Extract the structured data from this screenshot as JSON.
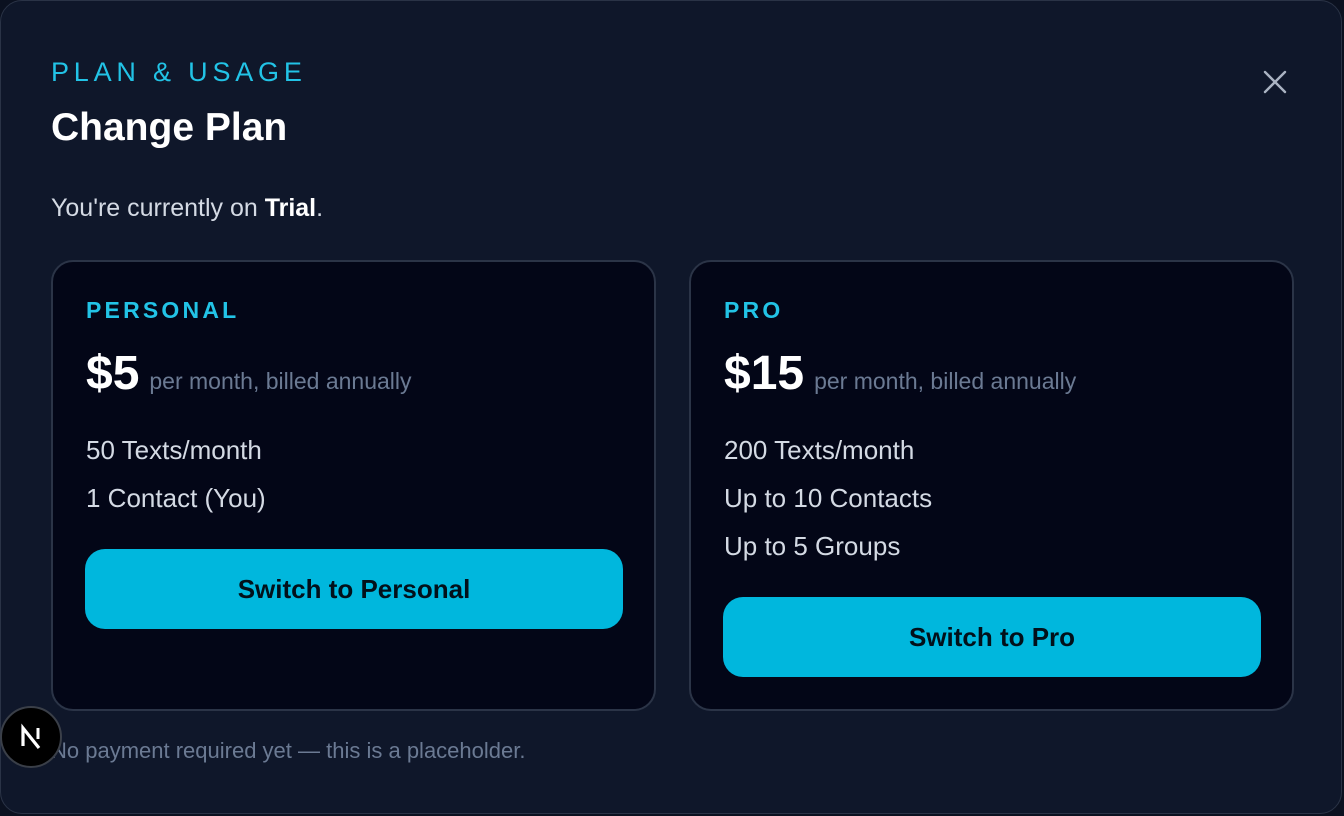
{
  "header": {
    "eyebrow": "PLAN & USAGE",
    "title": "Change Plan"
  },
  "current_plan": {
    "prefix": "You're currently on ",
    "plan": "Trial",
    "suffix": "."
  },
  "plans": [
    {
      "name": "PERSONAL",
      "price": "$5",
      "billing": "per month, billed annually",
      "features": [
        "50 Texts/month",
        "1 Contact (You)"
      ],
      "button_label": "Switch to Personal"
    },
    {
      "name": "PRO",
      "price": "$15",
      "billing": "per month, billed annually",
      "features": [
        "200 Texts/month",
        "Up to 10 Contacts",
        "Up to 5 Groups"
      ],
      "button_label": "Switch to Pro"
    }
  ],
  "footnote": "No payment required yet — this is a placeholder.",
  "icons": {
    "close": "close-icon",
    "badge": "nextjs-logo-icon"
  },
  "colors": {
    "background": "#0f172a",
    "card_background": "#030617",
    "accent": "#22c3e6",
    "button": "#00b7dd",
    "muted_text": "#6b7a93"
  }
}
